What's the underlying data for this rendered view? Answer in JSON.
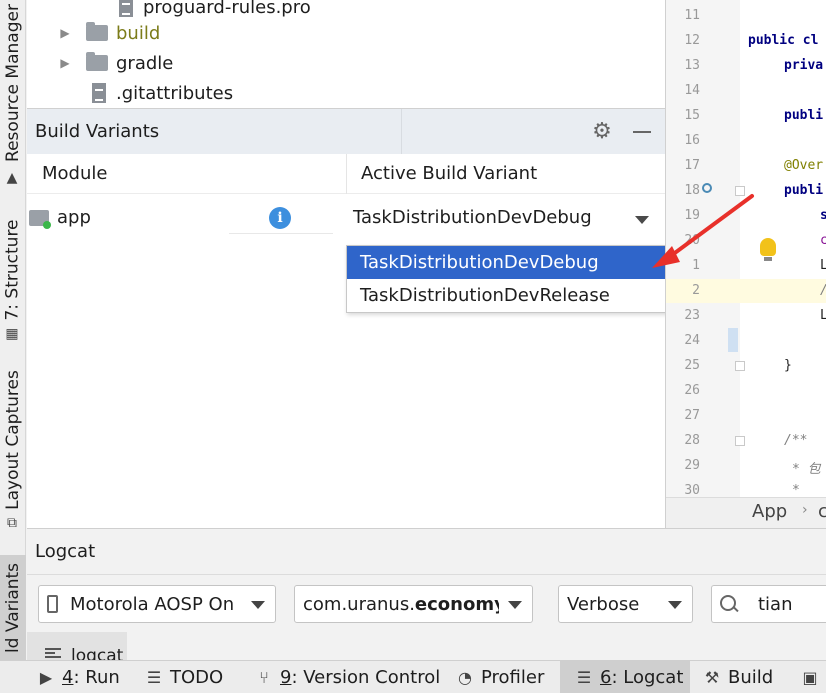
{
  "left_strip": {
    "resource_manager": "Resource Manager",
    "structure": "7: Structure",
    "layout_captures": "Layout Captures",
    "build_variants": "ld Variants"
  },
  "project_tree": {
    "items": [
      {
        "label": "proguard-rules.pro",
        "type": "file"
      },
      {
        "label": "build",
        "type": "folder"
      },
      {
        "label": "gradle",
        "type": "folder"
      },
      {
        "label": ".gitattributes",
        "type": "file"
      }
    ]
  },
  "build_variants": {
    "title": "Build Variants",
    "col_module": "Module",
    "col_variant": "Active Build Variant",
    "row": {
      "module": "app",
      "variant": "TaskDistributionDevDebug"
    },
    "dropdown_options": [
      "TaskDistributionDevDebug",
      "TaskDistributionDevRelease"
    ],
    "selected_option": "TaskDistributionDevDebug"
  },
  "editor": {
    "line_numbers": [
      "11",
      "12",
      "13",
      "14",
      "15",
      "16",
      "17",
      "18",
      "19",
      "20",
      "1",
      "2",
      "23",
      "24",
      "25",
      "26",
      "27",
      "28",
      "29",
      "30"
    ],
    "code": {
      "l12": "public cl",
      "l13": "priva",
      "l15": "publi",
      "l17": "@Over",
      "l18": "publi",
      "l19": "s",
      "l20": "c",
      "l21": "L",
      "l22": "/",
      "l23": "L",
      "l25": "}",
      "l28": "/**",
      "l29": "* 包",
      "l30": "*"
    },
    "breadcrumb": [
      "App",
      "c"
    ]
  },
  "logcat": {
    "title": "Logcat",
    "device": "Motorola AOSP On",
    "package_prefix": "com.uranus.",
    "package_bold": "economy",
    "level": "Verbose",
    "search_value": "tian",
    "tab_label": "logcat"
  },
  "statusbar": {
    "run_num": "4",
    "run": ": Run",
    "todo": "TODO",
    "vc_num": "9",
    "vc": ": Version Control",
    "profiler": "Profiler",
    "logcat_num": "6",
    "logcat": ": Logcat",
    "build": "Build"
  },
  "colors": {
    "selection": "#2f65ca",
    "annotation_arrow": "#e8302a",
    "info_icon": "#3d8fde"
  }
}
